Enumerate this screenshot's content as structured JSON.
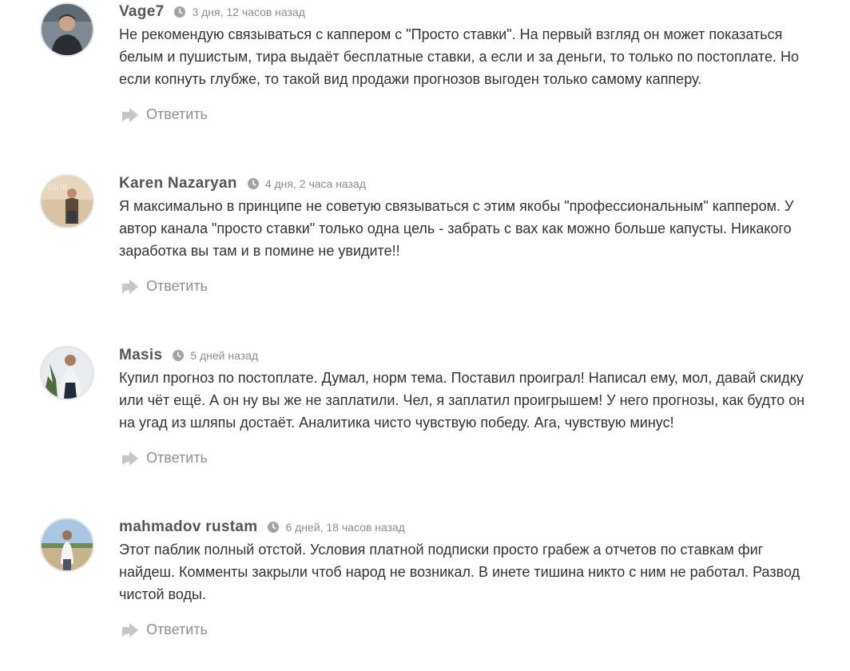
{
  "comments": [
    {
      "author": "Vage7",
      "date": "3 дня, 12 часов назад",
      "text": "Не рекомендую связываться с каппером с \"Просто ставки\". На первый взгляд он может показаться белым и пушистым, тира выдаёт бесплатные ставки, а если и за деньги, то только по постоплате. Но если копнуть глубже, то такой вид продажи прогнозов выгоден только самому капперу.",
      "reply_label": "Ответить"
    },
    {
      "author": "Karen Nazaryan",
      "date": "4 дня, 2 часа назад",
      "text": "Я максимально в принципе не советую связываться с этим якобы \"профессиональным\" каппером. У автор канала \"просто ставки\" только одна цель - забрать с вах как можно больше капусты. Никакого заработка вы там и в помине не увидите!!",
      "reply_label": "Ответить"
    },
    {
      "author": "Masis",
      "date": "5 дней назад",
      "text": "Купил прогноз по постоплате. Думал, норм тема. Поставил проиграл! Написал ему, мол, давай скидку или чёт ещё. А он ну вы же не заплатили. Чел, я заплатил проигрышем! У него прогнозы, как будто он на угад из шляпы достаёт. Аналитика чисто чувствую победу. Ага, чувствую минус!",
      "reply_label": "Ответить"
    },
    {
      "author": "mahmadov rustam",
      "date": "6 дней, 18 часов назад",
      "text": "Этот паблик полный отстой. Условия платной подписки просто грабеж а отчетов по ставкам фиг найдеш. Комменты закрыли чтоб народ не возникал. В инете тишина никто с ним не работал. Развод чистой воды.",
      "reply_label": "Ответить"
    }
  ],
  "colors": {
    "author": "#555555",
    "date": "#8c8c8c",
    "text": "#333333",
    "reply": "#8f8f8f"
  }
}
